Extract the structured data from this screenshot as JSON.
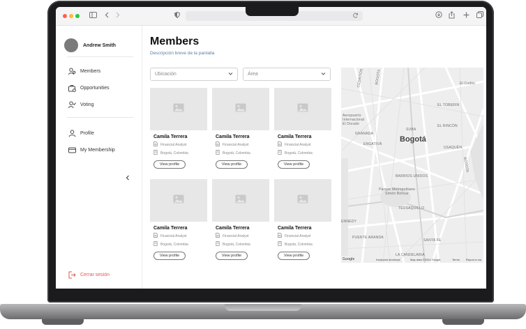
{
  "browser": {
    "url": ""
  },
  "user": {
    "name": "Andrew Smith"
  },
  "sidebar": {
    "items": [
      {
        "label": "Members",
        "icon": "users-icon"
      },
      {
        "label": "Opportunities",
        "icon": "briefcase-icon"
      },
      {
        "label": "Voting",
        "icon": "vote-icon"
      }
    ],
    "secondary": [
      {
        "label": "Profile",
        "icon": "user-icon"
      },
      {
        "label": "My Membership",
        "icon": "card-icon"
      }
    ],
    "collapse_icon": "chevron-left-icon",
    "logout_label": "Cerrar sesión"
  },
  "page": {
    "title": "Members",
    "subtitle": "Descripción breve de la pantalla"
  },
  "filters": {
    "ubicacion_placeholder": "Ubicación",
    "area_placeholder": "Área"
  },
  "members": [
    {
      "name": "Camila Terrera",
      "role": "Financial Analyst",
      "location": "Bogotá, Colombia",
      "button": "View profile"
    },
    {
      "name": "Camila Terrera",
      "role": "Financial Analyst",
      "location": "Bogotá, Colombia",
      "button": "View profile"
    },
    {
      "name": "Camila Terrera",
      "role": "Financial Analyst",
      "location": "Bogotá, Colombia",
      "button": "View profile"
    },
    {
      "name": "Camila Terrera",
      "role": "Financial Analyst",
      "location": "Bogotá, Colombia",
      "button": "View profile"
    },
    {
      "name": "Camila Terrera",
      "role": "Financial Analyst",
      "location": "Bogotá, Colombia",
      "button": "View profile"
    },
    {
      "name": "Camila Terrera",
      "role": "Financial Analyst",
      "location": "Bogotá, Colombia",
      "button": "View profile"
    }
  ],
  "map": {
    "city": "Bogotá",
    "labels": [
      "CEDRITOS",
      "BOGOTA",
      "El Codito",
      "EL TOBERIN",
      "SUBA",
      "EL RINCÓN",
      "ENGATIVÁ",
      "USAQUÉN",
      "BARRIOS UNIDOS",
      "Parque Metropolitano Simón Bolívar",
      "TEUSAQUILLO",
      "PUENTE ARANDA",
      "SANTA FE",
      "LA CANDELARIA",
      "BOGOTA",
      "Aeropuerto Internacional El Dorado",
      "GRANADA",
      "ENNEDY"
    ],
    "footer": {
      "logo": "Google",
      "shortcuts": "Keyboard shortcuts",
      "data": "Map data ©2024 Google",
      "terms": "Terms",
      "report": "Report a ma"
    }
  },
  "colors": {
    "logout": "#e05a4e",
    "subtitle": "#5a7fa6",
    "placeholder": "#e7e7e7"
  }
}
